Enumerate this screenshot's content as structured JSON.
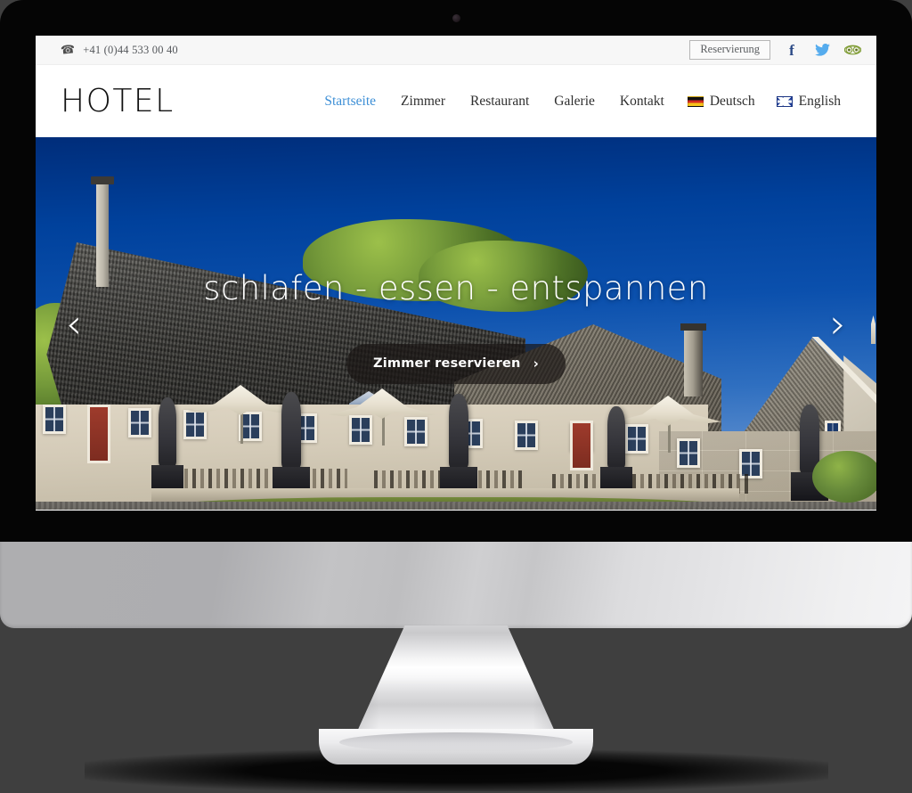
{
  "site": {
    "logo": "HOTEL",
    "topbar": {
      "phone": "+41 (0)44 533 00 40",
      "phone_icon": "phone-icon",
      "reservation_label": "Reservierung",
      "social": [
        {
          "name": "facebook-icon",
          "glyph": "f",
          "color": "#2b4a86"
        },
        {
          "name": "twitter-icon",
          "glyph": "",
          "color": "#55acee"
        },
        {
          "name": "tripadvisor-icon",
          "glyph": "",
          "color": "#7b9a2f"
        }
      ]
    },
    "nav": {
      "items": [
        {
          "label": "Startseite",
          "active": true
        },
        {
          "label": "Zimmer",
          "active": false
        },
        {
          "label": "Restaurant",
          "active": false
        },
        {
          "label": "Galerie",
          "active": false
        },
        {
          "label": "Kontakt",
          "active": false
        }
      ],
      "languages": [
        {
          "label": "Deutsch",
          "flag": "flag-de"
        },
        {
          "label": "English",
          "flag": "flag-uk"
        }
      ],
      "active_color": "#3d8fd6"
    },
    "hero": {
      "title": "schlafen - essen - entspannen",
      "cta_label": "Zimmer reservieren",
      "cta_chevron": "›",
      "prev_arrow": "‹",
      "next_arrow": "›",
      "image_description": "Historisches Hotelgebaeude mit Terrasse, Sonnenschirmen und Statuen vor blauem Himmel"
    }
  },
  "device": {
    "type": "desktop-monitor",
    "webcam": "webcam-dot"
  }
}
